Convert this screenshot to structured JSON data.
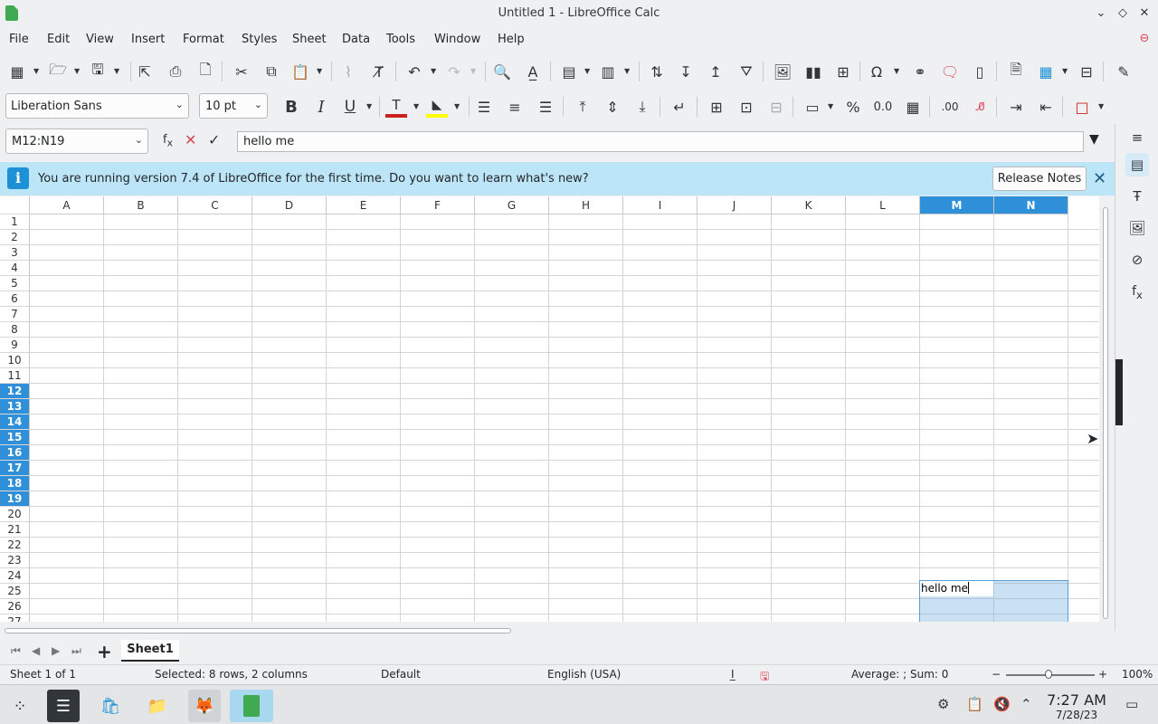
{
  "window": {
    "title": "Untitled 1 - LibreOffice Calc"
  },
  "menu": [
    "File",
    "Edit",
    "View",
    "Insert",
    "Format",
    "Styles",
    "Sheet",
    "Data",
    "Tools",
    "Window",
    "Help"
  ],
  "format": {
    "font_name": "Liberation Sans",
    "font_size": "10 pt"
  },
  "formula_bar": {
    "name_box": "M12:N19",
    "content": "hello me"
  },
  "infobar": {
    "message": "You are running version 7.4 of LibreOffice for the first time. Do you want to learn what's new?",
    "button": "Release Notes"
  },
  "columns": [
    "A",
    "B",
    "C",
    "D",
    "E",
    "F",
    "G",
    "H",
    "I",
    "J",
    "K",
    "L",
    "M",
    "N"
  ],
  "selected_columns": [
    "M",
    "N"
  ],
  "rows": [
    "1",
    "2",
    "3",
    "4",
    "5",
    "6",
    "7",
    "8",
    "9",
    "10",
    "11",
    "12",
    "13",
    "14",
    "15",
    "16",
    "17",
    "18",
    "19",
    "20",
    "21",
    "22",
    "23",
    "24",
    "25",
    "26",
    "27"
  ],
  "selected_rows": [
    "12",
    "13",
    "14",
    "15",
    "16",
    "17",
    "18",
    "19"
  ],
  "cell": {
    "ref": "M12",
    "value": "hello me"
  },
  "sheets": [
    {
      "name": "Sheet1",
      "active": true
    }
  ],
  "status": {
    "sheet": "Sheet 1 of 1",
    "selection": "Selected: 8 rows, 2 columns",
    "page_style": "Default",
    "language": "English (USA)",
    "sum": "Average: ; Sum: 0",
    "zoom": "100%",
    "zoom_value": 100
  },
  "clock": {
    "time": "7:27 AM",
    "date": "7/28/23"
  },
  "colors": {
    "selection_header": "#2f8fd8",
    "infobar": "#bde5f8",
    "app_green": "#3faa52"
  }
}
